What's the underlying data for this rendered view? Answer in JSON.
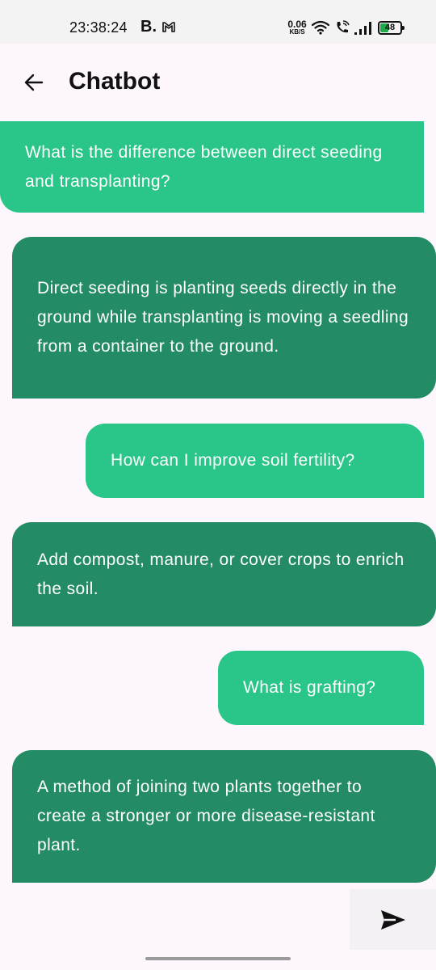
{
  "status_bar": {
    "time": "23:38:24",
    "carrier_icon_text": "B.",
    "speed_value": "0.06",
    "speed_unit": "KB/S",
    "battery": "48",
    "battery_level": 0.48
  },
  "app_bar": {
    "title": "Chatbot"
  },
  "messages": [
    {
      "role": "user",
      "text": "What is the difference between direct seeding and transplanting?"
    },
    {
      "role": "bot",
      "text": "Direct seeding is planting seeds directly in the ground while transplanting is moving a seedling from a container to the ground."
    },
    {
      "role": "user",
      "text": "How can I improve soil fertility?"
    },
    {
      "role": "bot",
      "text": "Add compost, manure, or cover crops to enrich the soil."
    },
    {
      "role": "user",
      "text": "What is grafting?"
    },
    {
      "role": "bot",
      "text": "A method of joining two plants together to create a stronger or more disease-resistant plant."
    }
  ],
  "input": {
    "value": "",
    "placeholder": ""
  },
  "colors": {
    "user_bubble": "#2ac589",
    "bot_bubble": "#238c64",
    "background": "#fdf7fd"
  },
  "icons": {
    "back": "arrow-back-icon",
    "send": "send-icon"
  }
}
